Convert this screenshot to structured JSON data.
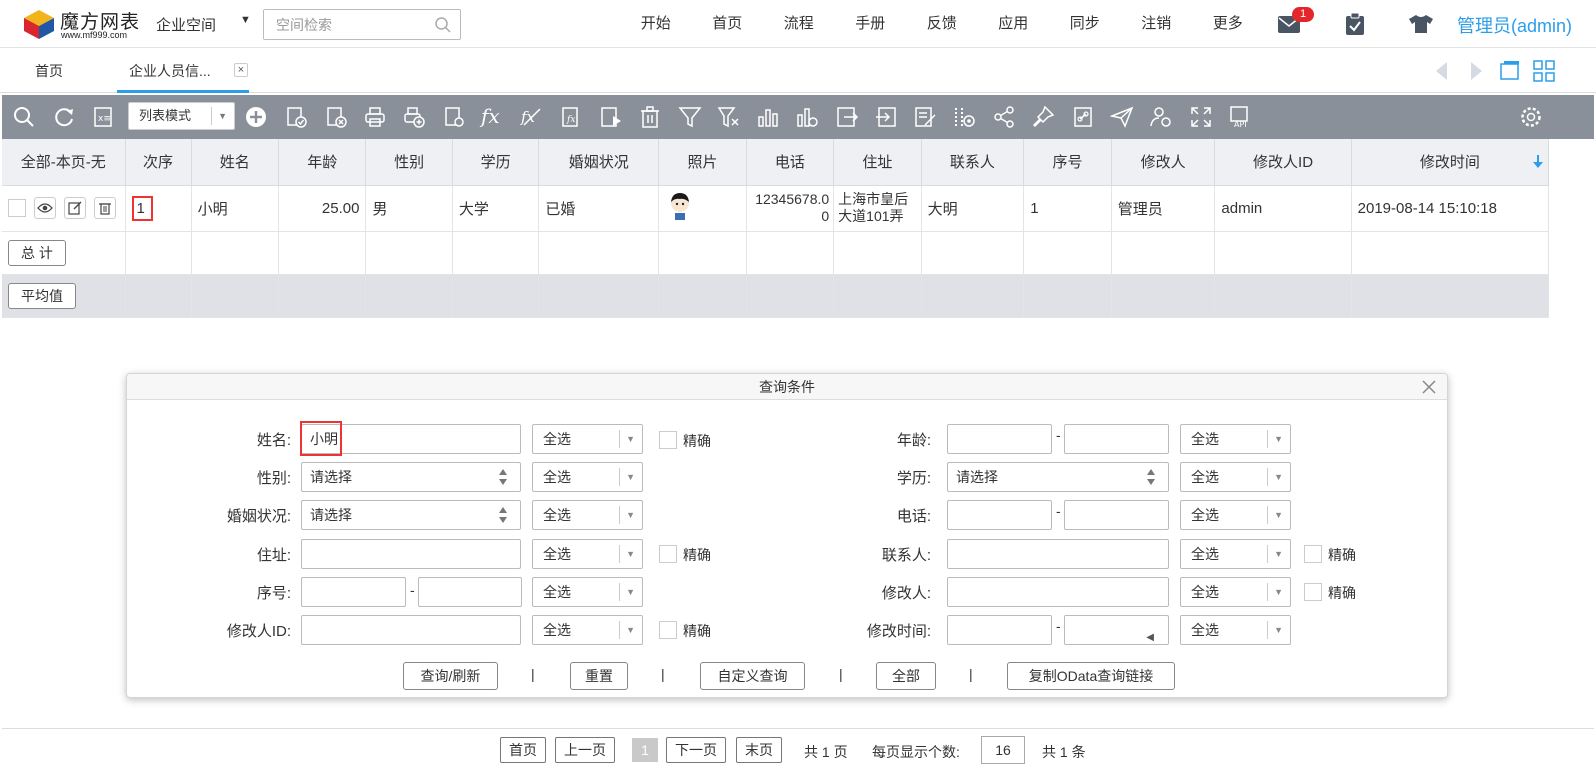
{
  "brand": {
    "title": "魔方网表",
    "url": "www.mf999.com"
  },
  "header": {
    "space_menu": "企业空间",
    "search_placeholder": "空间检索",
    "nav": [
      "开始",
      "首页",
      "流程",
      "手册",
      "反馈",
      "应用",
      "同步",
      "注销",
      "更多"
    ],
    "mail_badge": "1",
    "user": "管理员(admin)"
  },
  "tabs": {
    "home": "首页",
    "active": "企业人员信...",
    "close": "×"
  },
  "toolbar": {
    "mode": "列表模式",
    "fx": "fx"
  },
  "grid": {
    "columns": [
      "全部-本页-无",
      "次序",
      "姓名",
      "年龄",
      "性别",
      "学历",
      "婚姻状况",
      "照片",
      "电话",
      "住址",
      "联系人",
      "序号",
      "修改人",
      "修改人ID",
      "修改时间"
    ],
    "row": {
      "order": "1",
      "name": "小明",
      "age": "25.00",
      "gender": "男",
      "education": "大学",
      "marital": "已婚",
      "phone": "12345678.00",
      "address": "上海市皇后大道101弄",
      "contact": "大明",
      "seq": "1",
      "modifier": "管理员",
      "modifier_id": "admin",
      "modified_time": "2019-08-14 15:10:18"
    },
    "total_label": "总 计",
    "avg_label": "平均值"
  },
  "dialog": {
    "title": "查询条件",
    "labels": {
      "name": "姓名:",
      "gender": "性别:",
      "marital": "婚姻状况:",
      "address": "住址:",
      "seq": "序号:",
      "modifier_id": "修改人ID:",
      "age": "年龄:",
      "education": "学历:",
      "phone": "电话:",
      "contact": "联系人:",
      "modifier": "修改人:",
      "modified_time": "修改时间:"
    },
    "name_value": "小明",
    "please_select": "请选择",
    "select_all": "全选",
    "exact": "精确",
    "dash": "-",
    "buttons": [
      "查询/刷新",
      "重置",
      "自定义查询",
      "全部",
      "复制OData查询链接"
    ],
    "sep": "|"
  },
  "pager": {
    "first": "首页",
    "prev": "上一页",
    "current": "1",
    "next": "下一页",
    "last": "末页",
    "total_pages": "共 1 页",
    "page_size_label": "每页显示个数:",
    "page_size": "16",
    "total_items": "共 1 条"
  },
  "colors": {
    "accent": "#2c9ee9",
    "toolbar": "#8a9099",
    "badge": "#e4262b",
    "highlight": "#e33333"
  }
}
